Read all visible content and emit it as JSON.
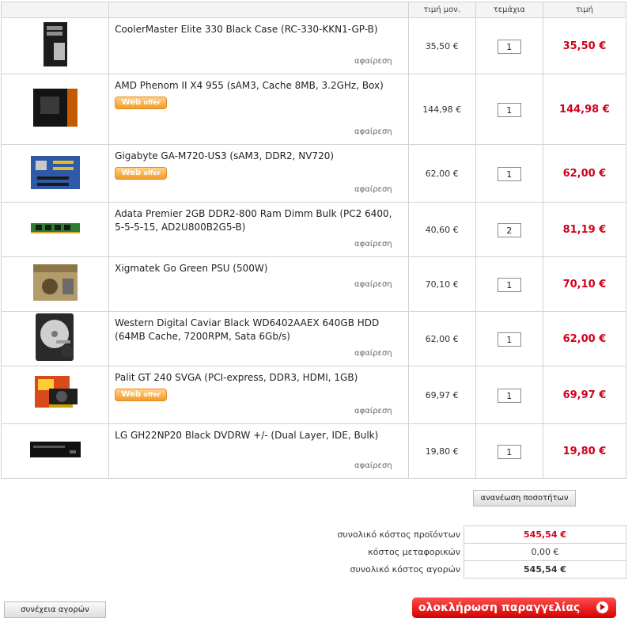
{
  "headers": {
    "unit_price": "τιμή μον.",
    "qty": "τεμάχια",
    "total": "τιμή"
  },
  "web_offer": {
    "web": "Web",
    "offer": "offer"
  },
  "remove_label": "αφαίρεση",
  "items": [
    {
      "name": "CoolerMaster Elite 330 Black Case (RC-330-KKN1-GP-B)",
      "unit_price": "35,50 €",
      "qty": "1",
      "total": "35,50 €",
      "thumb": "pc-case-icon"
    },
    {
      "name": "AMD Phenom II X4 955 (sAM3, Cache 8MB, 3.2GHz, Box)",
      "unit_price": "144,98 €",
      "qty": "1",
      "total": "144,98 €",
      "thumb": "cpu-box-icon"
    },
    {
      "name": "Gigabyte GA-M720-US3 (sAM3, DDR2, NV720)",
      "unit_price": "62,00 €",
      "qty": "1",
      "total": "62,00 €",
      "thumb": "motherboard-icon"
    },
    {
      "name": "Adata Premier 2GB DDR2-800 Ram Dimm Bulk (PC2 6400, 5-5-5-15, AD2U800B2G5-B)",
      "unit_price": "40,60 €",
      "qty": "2",
      "total": "81,19 €",
      "thumb": "ram-module-icon"
    },
    {
      "name": "Xigmatek Go Green PSU (500W)",
      "unit_price": "70,10 €",
      "qty": "1",
      "total": "70,10 €",
      "thumb": "psu-box-icon"
    },
    {
      "name": "Western Digital Caviar Black WD6402AAEX 640GB HDD (64MB Cache, 7200RPM, Sata 6Gb/s)",
      "unit_price": "62,00 €",
      "qty": "1",
      "total": "62,00 €",
      "thumb": "hard-drive-icon"
    },
    {
      "name": "Palit GT 240 SVGA (PCI-express, DDR3, HDMI, 1GB)",
      "unit_price": "69,97 €",
      "qty": "1",
      "total": "69,97 €",
      "thumb": "graphics-card-icon"
    },
    {
      "name": "LG GH22NP20 Black DVDRW +/- (Dual Layer, IDE, Bulk)",
      "unit_price": "19,80 €",
      "qty": "1",
      "total": "19,80 €",
      "thumb": "dvd-drive-icon"
    }
  ],
  "update_button": "ανανέωση ποσοτήτων",
  "totals": {
    "products_label": "συνολικό κόστος προϊόντων",
    "products_value": "545,54 €",
    "shipping_label": "κόστος μεταφορικών",
    "shipping_value": "0,00 €",
    "grand_label": "συνολικό κόστος αγορών",
    "grand_value": "545,54 €"
  },
  "continue_button": "συνέχεια αγορών",
  "checkout_button": "ολοκλήρωση παραγγελίας",
  "colors": {
    "price_red": "#d0021b",
    "offer_orange": "#f29b28"
  }
}
